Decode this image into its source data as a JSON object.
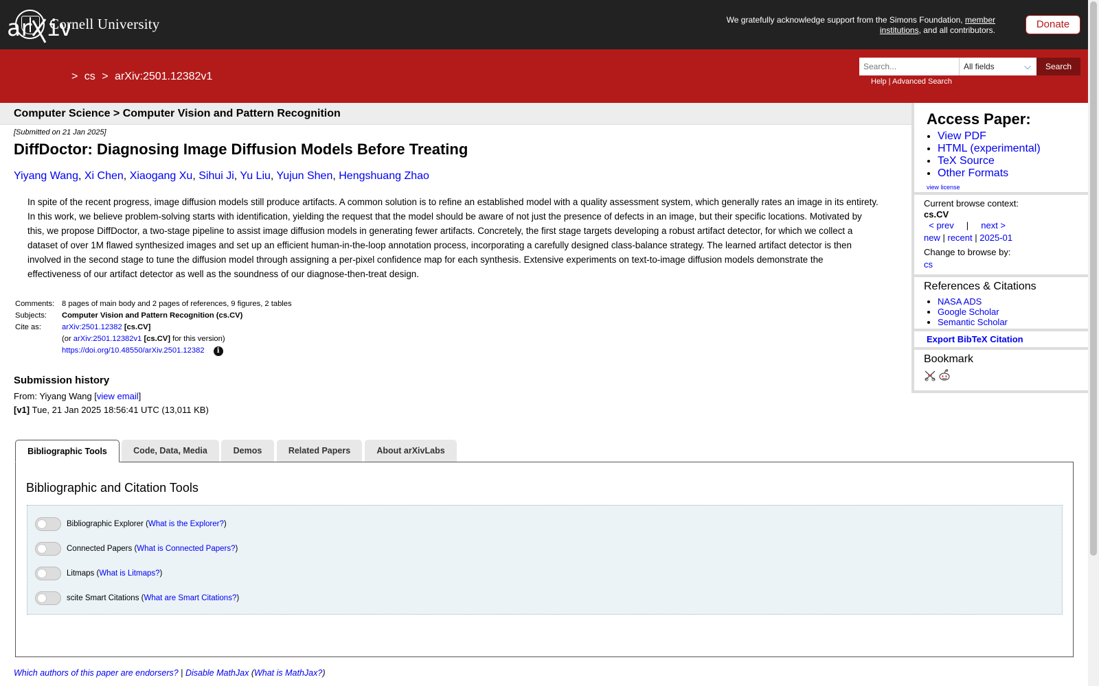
{
  "topbar": {
    "university": "Cornell University",
    "support_text": "We gratefully acknowledge support from the Simons Foundation,",
    "member_link": "member institutions",
    "support_tail": ", and all contributors.",
    "donate_label": "Donate"
  },
  "header": {
    "breadcrumb_sep1": ">",
    "breadcrumb_cs": "cs",
    "breadcrumb_sep2": ">",
    "breadcrumb_id": "arXiv:2501.12382v1",
    "search_placeholder": "Search...",
    "search_field": "All fields",
    "search_button": "Search",
    "help_link": "Help",
    "advanced_link": "Advanced Search",
    "link_sep": " | "
  },
  "paper": {
    "subject_crumb": "Computer Science > Computer Vision and Pattern Recognition",
    "submitted": "[Submitted on 21 Jan 2025]",
    "title": "DiffDoctor: Diagnosing Image Diffusion Models Before Treating",
    "authors": [
      "Yiyang Wang",
      "Xi Chen",
      "Xiaogang Xu",
      "Sihui Ji",
      "Yu Liu",
      "Yujun Shen",
      "Hengshuang Zhao"
    ],
    "abstract": "In spite of the recent progress, image diffusion models still produce artifacts. A common solution is to refine an established model with a quality assessment system, which generally rates an image in its entirety. In this work, we believe problem-solving starts with identification, yielding the request that the model should be aware of not just the presence of defects in an image, but their specific locations. Motivated by this, we propose DiffDoctor, a two-stage pipeline to assist image diffusion models in generating fewer artifacts. Concretely, the first stage targets developing a robust artifact detector, for which we collect a dataset of over 1M flawed synthesized images and set up an efficient human-in-the-loop annotation process, incorporating a carefully designed class-balance strategy. The learned artifact detector is then involved in the second stage to tune the diffusion model through assigning a per-pixel confidence map for each synthesis. Extensive experiments on text-to-image diffusion models demonstrate the effectiveness of our artifact detector as well as the soundness of our diagnose-then-treat design.",
    "meta": {
      "comments_label": "Comments:",
      "comments": "8 pages of main body and 2 pages of references, 9 figures, 2 tables",
      "subjects_label": "Subjects:",
      "subjects": "Computer Vision and Pattern Recognition (cs.CV)",
      "cite_label": "Cite as:",
      "cite_id": "arXiv:2501.12382",
      "cite_cat": "[cs.CV]",
      "or_prefix": "(or",
      "version_id": "arXiv:2501.12382v1",
      "version_cat": "[cs.CV]",
      "version_suffix": "for this version)",
      "doi": "https://doi.org/10.48550/arXiv.2501.12382"
    },
    "history": {
      "heading": "Submission history",
      "from_prefix": "From: Yiyang Wang [",
      "view_email": "view email",
      "from_suffix": "]",
      "v1_label": "[v1]",
      "v1_text": "Tue, 21 Jan 2025 18:56:41 UTC (13,011 KB)"
    }
  },
  "sidebar": {
    "access_heading": "Access Paper:",
    "access_links": [
      "View PDF",
      "HTML (experimental)",
      "TeX Source",
      "Other Formats"
    ],
    "view_license": "view license",
    "browse_context_label": "Current browse context:",
    "browse_context": "cs.CV",
    "prev": "< prev",
    "pipe": "|",
    "next": "next >",
    "new": "new",
    "recent": "recent",
    "month": "2025-01",
    "change_browse": "Change to browse by:",
    "browse_cs": "cs",
    "refs_heading": "References & Citations",
    "refs_links": [
      "NASA ADS",
      "Google Scholar",
      "Semantic Scholar"
    ],
    "bibtex": "Export BibTeX Citation",
    "bookmark_heading": "Bookmark"
  },
  "tabs": [
    {
      "label": "Bibliographic Tools"
    },
    {
      "label": "Code, Data, Media"
    },
    {
      "label": "Demos"
    },
    {
      "label": "Related Papers"
    },
    {
      "label": "About arXivLabs"
    }
  ],
  "tools": {
    "heading": "Bibliographic and Citation Tools",
    "items": [
      {
        "name": "Bibliographic Explorer",
        "link": "What is the Explorer?"
      },
      {
        "name": "Connected Papers",
        "link": "What is Connected Papers?"
      },
      {
        "name": "Litmaps",
        "link": "What is Litmaps?"
      },
      {
        "name": "scite Smart Citations",
        "link": "What are Smart Citations?"
      }
    ]
  },
  "footer": {
    "endorsers": "Which authors of this paper are endorsers?",
    "sep": "|",
    "disable_mathjax": "Disable MathJax",
    "what_mathjax": "What is MathJax?"
  },
  "colors": {
    "arxiv_red": "#b31b1b",
    "topbar": "#222222",
    "link": "#0000ee"
  }
}
